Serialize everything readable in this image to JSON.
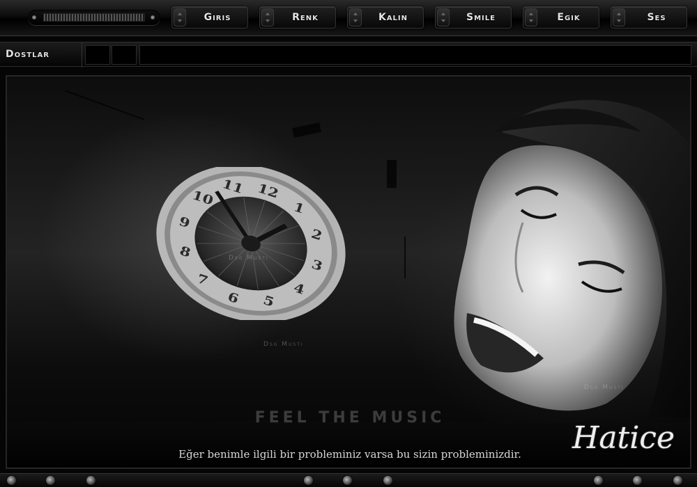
{
  "toolbar": {
    "buttons": [
      {
        "label": "Giris"
      },
      {
        "label": "Renk"
      },
      {
        "label": "Kalın"
      },
      {
        "label": "Smile"
      },
      {
        "label": "Egik"
      },
      {
        "label": "Ses"
      }
    ]
  },
  "subbar": {
    "label": "Dostlar"
  },
  "banner": {
    "watermarks": [
      "Dsg Musti",
      "Dsg Musti",
      "Dsg Musti"
    ],
    "tagline": "FEEL THE MUSIC",
    "quote": "Eğer benimle ilgili bir probleminiz varsa bu sizin probleminizdir.",
    "signature": "Hatice"
  },
  "colors": {
    "background": "#050505",
    "text": "#e4e4e4",
    "accent": "#3c3c3c"
  }
}
